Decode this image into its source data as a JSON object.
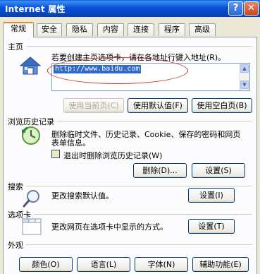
{
  "window": {
    "title": "Internet 属性",
    "help_label": "?",
    "close_label": "✕"
  },
  "tabs": [
    {
      "label": "常规",
      "active": true
    },
    {
      "label": "安全"
    },
    {
      "label": "隐私"
    },
    {
      "label": "内容"
    },
    {
      "label": "连接"
    },
    {
      "label": "程序"
    },
    {
      "label": "高级"
    }
  ],
  "homepage": {
    "group": "主页",
    "instruction": "若要创建主页选项卡，请在各地址行键入地址(R)。",
    "url": "http://www.baidu.com",
    "buttons": {
      "current": "使用当前页(C)",
      "default": "使用默认值(F)",
      "blank": "使用空白页(B)"
    }
  },
  "history": {
    "group": "浏览历史记录",
    "description_line1": "删除临时文件、历史记录、Cookie、保存的密码和网页",
    "description_line2": "表单信息。",
    "checkbox_label": "退出时删除浏览历史记录(W)",
    "delete_button": "删除(D)...",
    "settings_button": "设置(S)"
  },
  "search": {
    "group": "搜索",
    "description": "更改搜索默认值。",
    "settings_button": "设置(I)"
  },
  "tabs_section": {
    "group": "选项卡",
    "description": "更改网页在选项卡中显示的方式。",
    "settings_button": "设置(T)"
  },
  "appearance": {
    "group": "外观",
    "buttons": {
      "colors": "颜色(O)",
      "languages": "语言(L)",
      "fonts": "字体(N)",
      "accessibility": "辅助功能(E)"
    }
  },
  "colors": {
    "titlebar": "#0a5ad6",
    "annotation_circle": "#c8312f",
    "selection": "#316ac5"
  }
}
